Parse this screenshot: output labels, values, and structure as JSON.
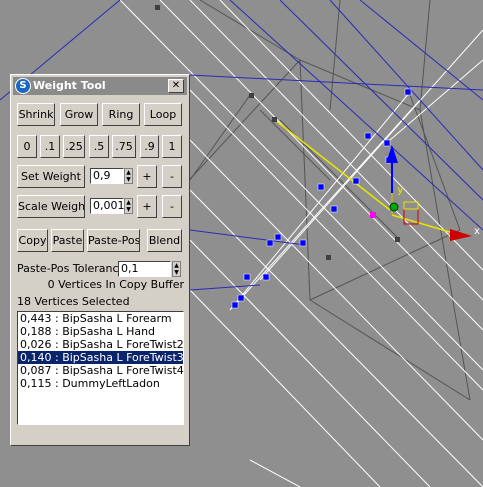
{
  "window": {
    "title": "Weight Tool",
    "close_glyph": "✕",
    "icon": "3dsmax-logo-icon"
  },
  "row1": [
    "Shrink",
    "Grow",
    "Ring",
    "Loop"
  ],
  "presets": [
    "0",
    ".1",
    ".25",
    ".5",
    ".75",
    ".9",
    "1"
  ],
  "set_weight": {
    "label": "Set Weight",
    "value": "0,9",
    "plus": "+",
    "minus": "-"
  },
  "scale_weight": {
    "label": "Scale Weight",
    "value": "0,001",
    "plus": "+",
    "minus": "-"
  },
  "copy_row": [
    "Copy",
    "Paste",
    "Paste-Pos",
    "Blend"
  ],
  "tolerance": {
    "label": "Paste-Pos Tolerance",
    "value": "0,1"
  },
  "buffer_text": "0 Vertices In Copy Buffer",
  "selected_text": "18 Vertices Selected",
  "bones": [
    {
      "text": "0,443 : BipSasha L Forearm",
      "selected": false
    },
    {
      "text": "0,188 : BipSasha L Hand",
      "selected": false
    },
    {
      "text": "0,026 : BipSasha L ForeTwist2",
      "selected": false
    },
    {
      "text": "0,140 : BipSasha L ForeTwist3",
      "selected": true
    },
    {
      "text": "0,087 : BipSasha L ForeTwist4",
      "selected": false
    },
    {
      "text": "0,115 : DummyLeftLadon",
      "selected": false
    }
  ],
  "gizmo": {
    "y_axis_label": "y",
    "x_axis_label": "x"
  },
  "colors": {
    "viewport_bg": "#8f8f8f",
    "selection": "#0a246a",
    "panel_bg": "#d4d0c8"
  }
}
